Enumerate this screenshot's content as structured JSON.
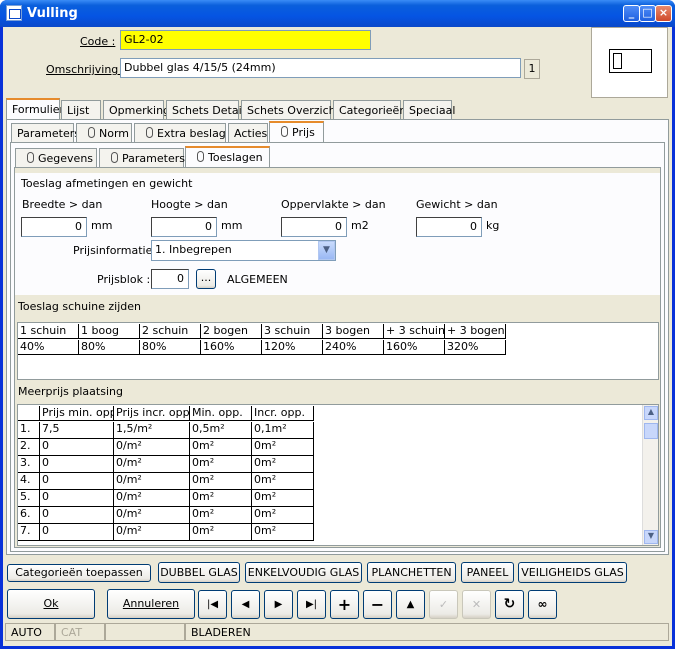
{
  "window": {
    "title": "Vulling"
  },
  "form": {
    "code_label": "Code :",
    "code_value": "GL2-02",
    "omschrijving_label": "Omschrijving :",
    "omschrijving_value": "Dubbel glas 4/15/5 (24mm)",
    "omschrijving_count": "1"
  },
  "main_tabs": [
    "Formulier",
    "Lijst",
    "Opmerking",
    "Schets Detail",
    "Schets Overzicht",
    "Categorieën",
    "Speciaal"
  ],
  "sub_tabs": [
    "Parameters",
    "Norm",
    "Extra beslag",
    "Acties",
    "Prijs"
  ],
  "prijs_tabs": [
    "Gegevens",
    "Parameters",
    "Toeslagen"
  ],
  "toeslag": {
    "section": "Toeslag afmetingen en gewicht",
    "breedte_label": "Breedte > dan",
    "breedte_value": "0",
    "breedte_unit": "mm",
    "hoogte_label": "Hoogte > dan",
    "hoogte_value": "0",
    "hoogte_unit": "mm",
    "opp_label": "Oppervlakte > dan",
    "opp_value": "0",
    "opp_unit": "m2",
    "gewicht_label": "Gewicht > dan",
    "gewicht_value": "0",
    "gewicht_unit": "kg",
    "prijsinfo_label": "Prijsinformatie :",
    "prijsinfo_value": "1. Inbegrepen",
    "prijsblok_label": "Prijsblok :",
    "prijsblok_value": "0",
    "prijsblok_btn": "...",
    "prijsblok_name": "ALGEMEEN"
  },
  "schuine": {
    "section": "Toeslag schuine zijden",
    "headers": [
      "1 schuin",
      "1 boog",
      "2 schuin",
      "2 bogen",
      "3 schuin",
      "3 bogen",
      "+ 3 schuin",
      "+ 3 bogen"
    ],
    "values": [
      "40%",
      "80%",
      "80%",
      "160%",
      "120%",
      "240%",
      "160%",
      "320%"
    ]
  },
  "meerprijs": {
    "section": "Meerprijs plaatsing",
    "headers": [
      "",
      "Prijs min. opp.",
      "Prijs incr. opp.",
      "Min. opp.",
      "Incr. opp."
    ],
    "rows": [
      [
        "1.",
        "7,5",
        "1,5/m²",
        "0,5m²",
        "0,1m²"
      ],
      [
        "2.",
        "0",
        "0/m²",
        "0m²",
        "0m²"
      ],
      [
        "3.",
        "0",
        "0/m²",
        "0m²",
        "0m²"
      ],
      [
        "4.",
        "0",
        "0/m²",
        "0m²",
        "0m²"
      ],
      [
        "5.",
        "0",
        "0/m²",
        "0m²",
        "0m²"
      ],
      [
        "6.",
        "0",
        "0/m²",
        "0m²",
        "0m²"
      ],
      [
        "7.",
        "0",
        "0/m²",
        "0m²",
        "0m²"
      ]
    ]
  },
  "category_buttons": [
    "Categorieën toepassen",
    "DUBBEL GLAS",
    "ENKELVOUDIG GLAS",
    "PLANCHETTEN",
    "PANEEL",
    "VEILIGHEIDS GLAS"
  ],
  "actions": {
    "ok": "Ok",
    "annuleren": "Annuleren"
  },
  "status": {
    "mode": "AUTO",
    "cat": "CAT",
    "state": "BLADEREN"
  }
}
